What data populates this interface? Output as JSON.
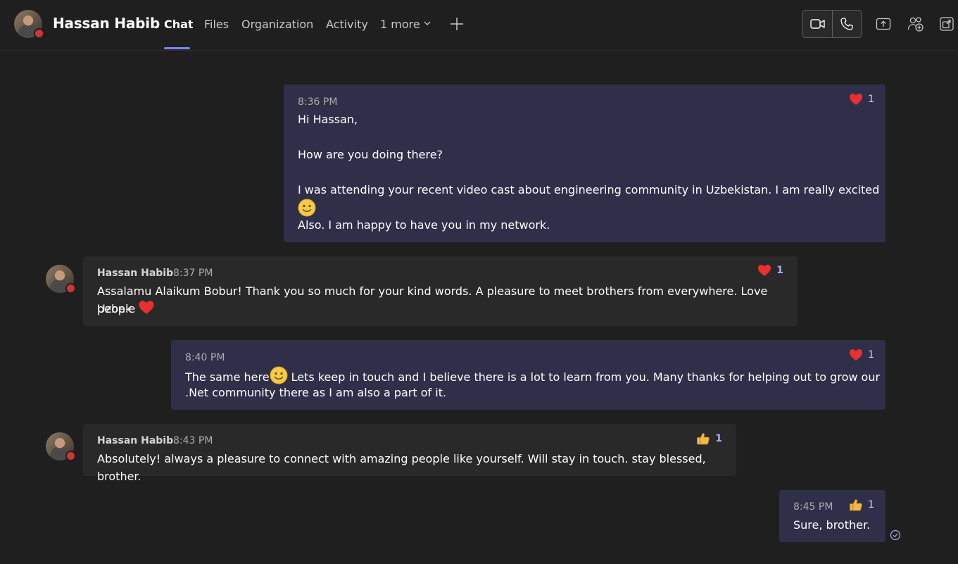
{
  "header": {
    "contact_name": "Hassan Habib",
    "tabs": [
      {
        "label": "Chat",
        "active": true
      },
      {
        "label": "Files",
        "active": false
      },
      {
        "label": "Organization",
        "active": false
      },
      {
        "label": "Activity",
        "active": false
      },
      {
        "label": "1 more",
        "active": false
      }
    ],
    "icons": [
      "chevron-down-icon",
      "add-tab-icon",
      "video-call-icon",
      "audio-call-icon",
      "share-screen-icon",
      "add-people-icon",
      "pop-out-icon"
    ]
  },
  "colors": {
    "accent": "#7f85f5",
    "my_bubble": "#2f2f4a",
    "their_bubble": "#292929",
    "presence_busy": "#d13438",
    "heart": "#e8312f"
  },
  "messages": [
    {
      "sender": "me",
      "time": "8:36 PM",
      "lines": [
        "Hi Hassan,",
        "How are you doing there?",
        "I was attending your recent video cast about engineering community in Uzbekistan. I am really excited",
        "Also. I am happy to have you in my network."
      ],
      "reaction": {
        "icon": "heart-icon",
        "count": "1"
      }
    },
    {
      "sender": "them",
      "author": "Hassan Habib",
      "time": "8:37 PM",
      "text_line1": "Assalamu Alaikum Bobur! Thank you so much for your kind words. A pleasure to meet brothers from everywhere. Love Uzbek",
      "text_line2": "people",
      "reaction": {
        "icon": "heart-icon",
        "count": "1"
      }
    },
    {
      "sender": "me",
      "time": "8:40 PM",
      "text_part1": "The same here",
      "text_part2": " Lets keep in touch and I believe there is a lot to learn from you. Many thanks for helping out to grow our",
      "text_line2": ".Net community there as I am also a part of it.",
      "reaction": {
        "icon": "heart-icon",
        "count": "1"
      }
    },
    {
      "sender": "them",
      "author": "Hassan Habib",
      "time": "8:43 PM",
      "text": "Absolutely! always a pleasure to connect with amazing people like yourself. Will stay in touch. stay blessed, brother.",
      "reaction": {
        "icon": "thumbs-up-icon",
        "count": "1"
      }
    },
    {
      "sender": "me",
      "time": "8:45 PM",
      "text": "Sure, brother.",
      "reaction": {
        "icon": "thumbs-up-icon",
        "count": "1"
      },
      "status_icon": "seen-check-icon"
    }
  ]
}
